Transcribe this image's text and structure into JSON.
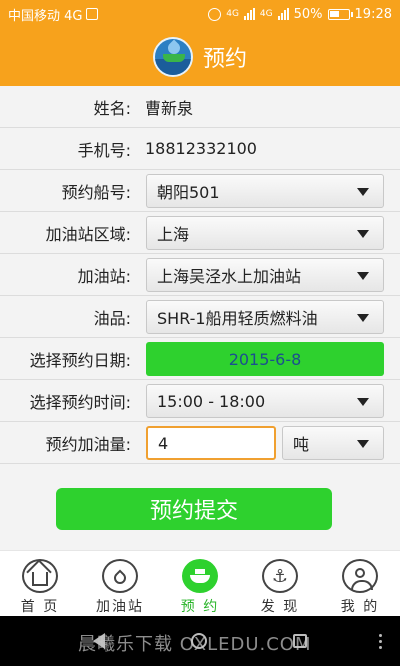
{
  "statusbar": {
    "carrier": "中国移动 4G",
    "net1": "4G",
    "net2": "4G",
    "battery": "50%",
    "time": "19:28"
  },
  "header": {
    "title": "预约"
  },
  "form": {
    "name_label": "姓名:",
    "name_value": "曹新泉",
    "phone_label": "手机号:",
    "phone_value": "18812332100",
    "ship_label": "预约船号:",
    "ship_value": "朝阳501",
    "region_label": "加油站区域:",
    "region_value": "上海",
    "station_label": "加油站:",
    "station_value": "上海吴泾水上加油站",
    "oil_label": "油品:",
    "oil_value": "SHR-1船用轻质燃料油",
    "date_label": "选择预约日期:",
    "date_value": "2015-6-8",
    "time_label": "选择预约时间:",
    "time_value": "15:00 - 18:00",
    "qty_label": "预约加油量:",
    "qty_value": "4",
    "unit_value": "吨"
  },
  "submit_label": "预约提交",
  "tabs": [
    {
      "label": "首 页",
      "icon": "home-icon"
    },
    {
      "label": "加油站",
      "icon": "droplet-icon"
    },
    {
      "label": "预 约",
      "icon": "ship-icon"
    },
    {
      "label": "发 现",
      "icon": "anchor-icon"
    },
    {
      "label": "我 的",
      "icon": "person-icon"
    }
  ],
  "watermark": "晨曦乐下载 OXLEDU.COM",
  "colors": {
    "header": "#f7a21c",
    "accent_green": "#2ed12e",
    "input_border": "#f0a030"
  }
}
